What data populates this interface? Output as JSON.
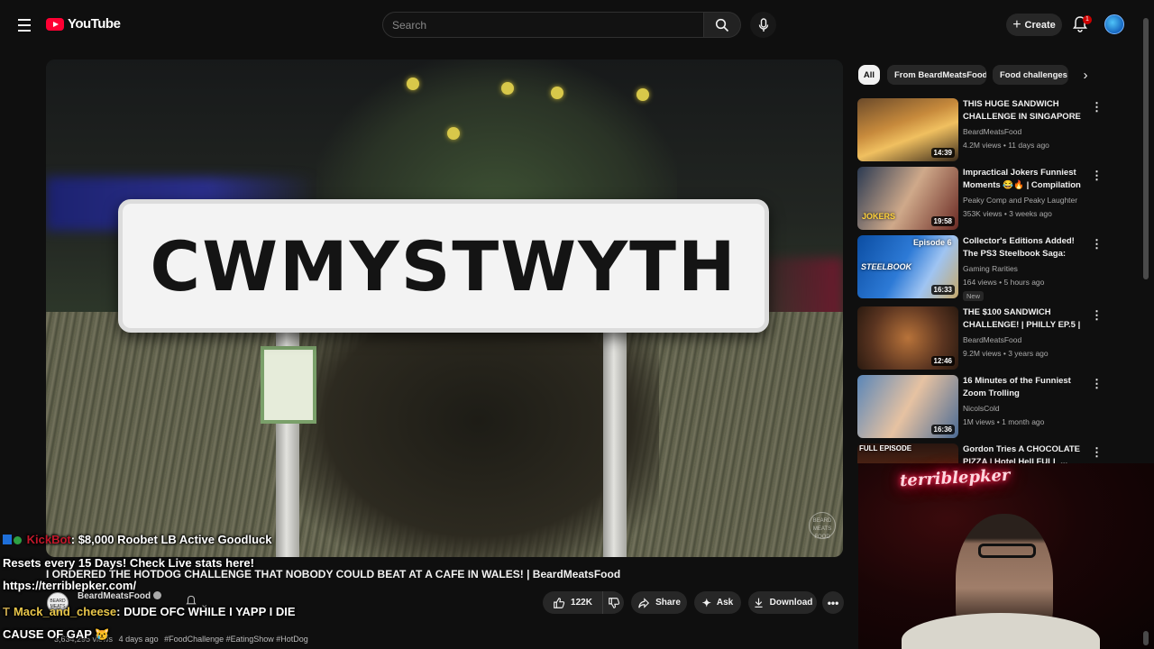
{
  "header": {
    "logo_text": "YouTube",
    "search_placeholder": "Search",
    "create_label": "Create",
    "notification_count": "1"
  },
  "player": {
    "sign_text": "CWMYSTWYTH",
    "watermark_text": "BEARD MEATS FOOD"
  },
  "video": {
    "title": "I ORDERED THE HOTDOG CHALLENGE THAT NOBODY COULD BEAT AT A CAFE IN WALES! | BeardMeatsFood",
    "channel": "BeardMeatsFood",
    "views": "3,634,295 views",
    "age": "4 days ago",
    "hashtags": "#FoodChallenge #EatingShow #HotDog",
    "like_count": "122K",
    "share_label": "Share",
    "ask_label": "Ask",
    "download_label": "Download"
  },
  "chat": [
    {
      "user": "KickBot",
      "text": ": $8,000 Roobet LB Active Goodluck"
    },
    {
      "user": "",
      "text": "Resets every 15 Days! Check Live stats here!"
    },
    {
      "user": "",
      "text": "https://terriblepker.com/"
    },
    {
      "user": "Mack_and_cheese",
      "text": ": DUDE OFC WHILE I YAPP I DIE"
    },
    {
      "user": "",
      "text": "CAUSE OF GAP"
    }
  ],
  "sidebar": {
    "chips": [
      "All",
      "From BeardMeatsFood",
      "Food challenges"
    ],
    "recommendations": [
      {
        "title": "THIS HUGE SANDWICH CHALLENGE IN SINGAPORE ...",
        "channel": "BeardMeatsFood",
        "meta": "4.2M views • 11 days ago",
        "duration": "14:39",
        "badge": ""
      },
      {
        "title": "Impractical Jokers Funniest Moments 😂🔥 | Compilation ...",
        "channel": "Peaky Comp and Peaky Laughter",
        "meta": "353K views • 3 weeks ago",
        "duration": "19:58",
        "badge": ""
      },
      {
        "title": "Collector's Editions Added! The PS3 Steelbook Saga: Episode 6",
        "channel": "Gaming Rarities",
        "meta": "164 views • 5 hours ago",
        "duration": "16:33",
        "badge": "New"
      },
      {
        "title": "THE $100 SANDWICH CHALLENGE! | PHILLY EP.5 | ...",
        "channel": "BeardMeatsFood",
        "meta": "9.2M views • 3 years ago",
        "duration": "12:46",
        "badge": ""
      },
      {
        "title": "16 Minutes of the Funniest Zoom Trolling",
        "channel": "NicolsCold",
        "meta": "1M views • 1 month ago",
        "duration": "16:36",
        "badge": ""
      },
      {
        "title": "Gordon Tries A CHOCOLATE PIZZA | Hotel Hell FULL ...",
        "channel": "",
        "meta": "",
        "duration": "",
        "badge": ""
      }
    ],
    "thumb_labels": {
      "jokers": "JOKERS",
      "episode": "Episode 6",
      "steelbook": "STEELBOOK",
      "full_episode": "FULL EPISODE"
    }
  },
  "webcam": {
    "neon_text": "terriblepker"
  },
  "colors": {
    "accent_red": "#ff0033",
    "background": "#0f0f0f",
    "chip_bg": "#272727"
  }
}
